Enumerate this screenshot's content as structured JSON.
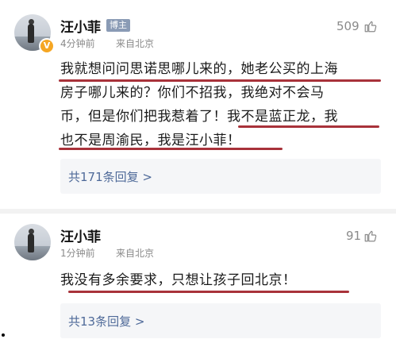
{
  "comments": [
    {
      "author": "汪小菲",
      "tag": "博主",
      "time": "4分钟前",
      "source": "来自北京",
      "likes": "509",
      "lines": [
        "我就想问问思诺思哪儿来的，她老公买的上海",
        "房子哪儿来的？你们不招我，我绝对不会马",
        "币，但是你们把我惹着了！我不是蓝正龙，我",
        "也不是周渝民，我是汪小菲！"
      ],
      "replies": "共171条回复 >"
    },
    {
      "author": "汪小菲",
      "time": "1分钟前",
      "source": "来自北京",
      "likes": "91",
      "lines": [
        "我没有多余要求，只想让孩子回北京！"
      ],
      "replies": "共13条回复 >"
    }
  ],
  "colors": {
    "underline": "#a8323a",
    "reply_link": "#4f6a99",
    "verified_badge": "#f5a623",
    "tag_bg": "#8a9bb5"
  },
  "icons": {
    "like": "thumbs-up-icon",
    "verified": "verified-v-icon"
  }
}
